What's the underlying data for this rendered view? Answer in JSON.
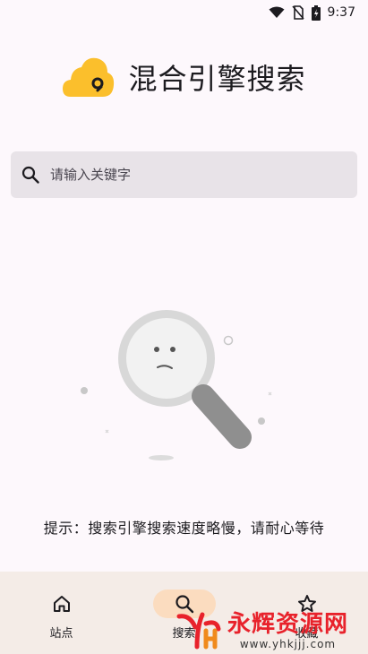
{
  "status_bar": {
    "time": "9:37",
    "icons": [
      "wifi-icon",
      "no-sim-icon",
      "battery-icon"
    ]
  },
  "header": {
    "logo": "cloud-search-logo",
    "title": "混合引擎搜索"
  },
  "search": {
    "placeholder": "请输入关键字",
    "value": "",
    "icon": "search-icon"
  },
  "empty_state": {
    "illustration": "magnifier-sad-face",
    "hint": "提示：搜索引擎搜索速度略慢，请耐心等待"
  },
  "bottom_nav": {
    "items": [
      {
        "label": "站点",
        "icon": "home-icon",
        "active": false
      },
      {
        "label": "搜索",
        "icon": "search-icon",
        "active": true
      },
      {
        "label": "收藏",
        "icon": "star-icon",
        "active": false
      }
    ]
  },
  "watermark": {
    "text": "永辉资源网",
    "url": "www.yhkjjj.com"
  },
  "colors": {
    "accent": "#fbbf2c",
    "nav_active": "#fbdcbf",
    "nav_bg": "#f4ece7",
    "search_bg": "#e8e3e8",
    "watermark": "#e8222b"
  }
}
